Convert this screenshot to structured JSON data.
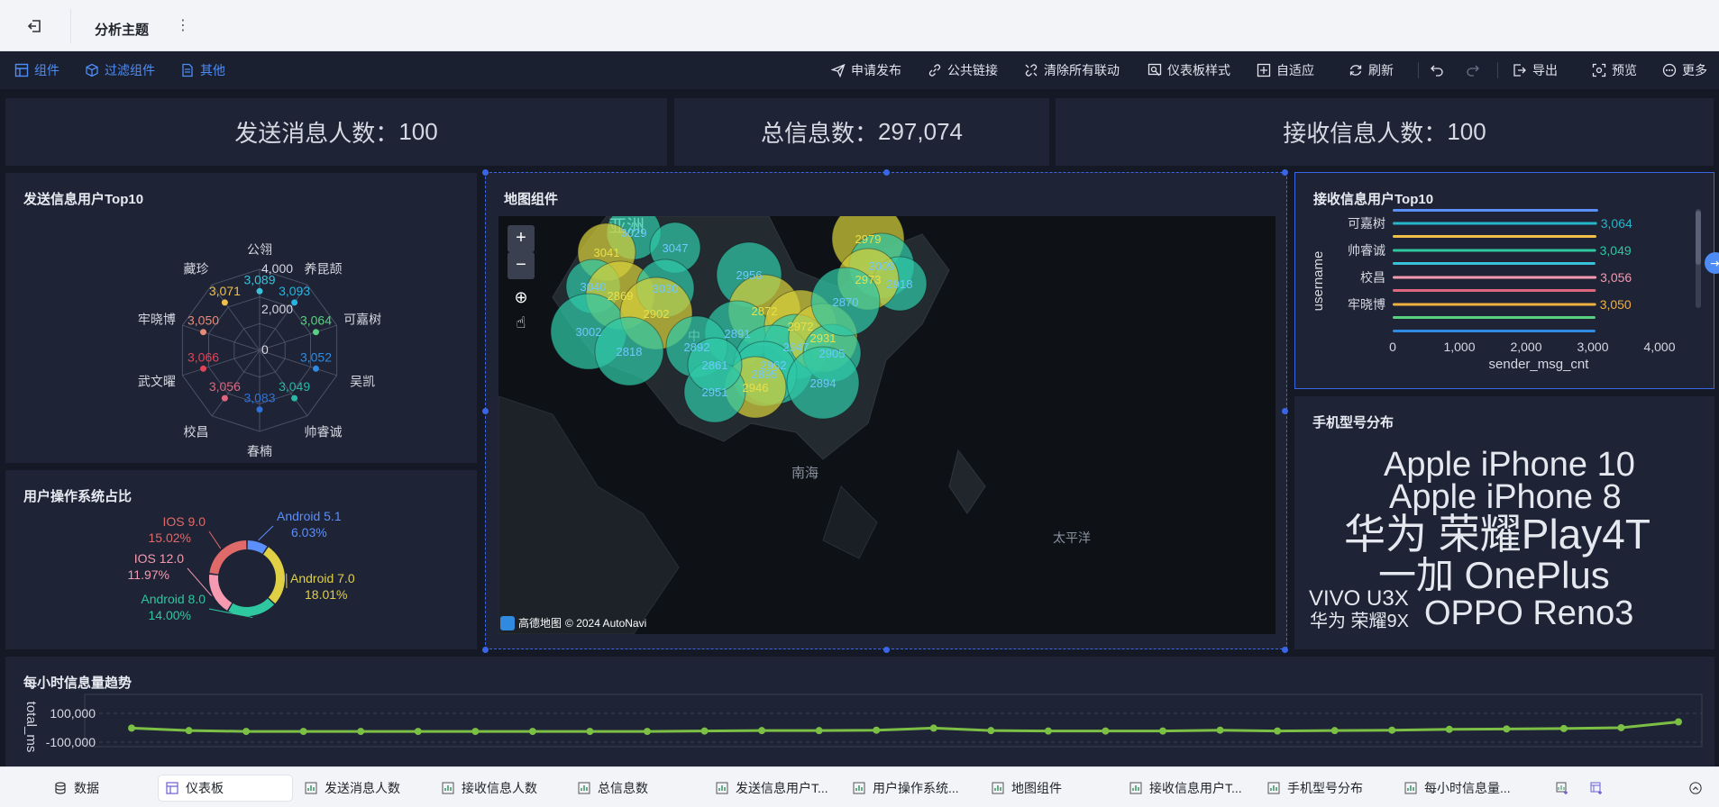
{
  "topbar": {
    "title": "分析主题"
  },
  "toolbar": {
    "left": [
      "组件",
      "过滤组件",
      "其他"
    ],
    "right": {
      "publish": "申请发布",
      "public_link": "公共链接",
      "clear_links": "清除所有联动",
      "style": "仪表板样式",
      "adapt": "自适应",
      "refresh": "刷新",
      "export": "导出",
      "preview": "预览",
      "more": "更多"
    }
  },
  "kpis": [
    {
      "label": "发送消息人数",
      "value": "100"
    },
    {
      "label": "总信息数",
      "value": "297,074"
    },
    {
      "label": "接收信息人数",
      "value": "100"
    }
  ],
  "cards": {
    "send_top10": "发送信息用户Top10",
    "os_share": "用户操作系统占比",
    "map": "地图组件",
    "recv_top10": "接收信息用户Top10",
    "phone_models": "手机型号分布",
    "hourly": "每小时信息量趋势"
  },
  "radar": {
    "axis_ticks": [
      "4,000",
      "2,000",
      "0"
    ],
    "names": [
      "公翎",
      "养昆颉",
      "可嘉树",
      "吴凯",
      "帅睿诚",
      "春楠",
      "校昌",
      "武文曜",
      "牢晓博",
      "藏珍"
    ],
    "values": [
      "3,089",
      "3,093",
      "3,064",
      "3,052",
      "3,049",
      "3,083",
      "3,056",
      "3,066",
      "3,050",
      "3,071"
    ],
    "colors": [
      "#38c2d9",
      "#27b5e0",
      "#58d080",
      "#2f8ae0",
      "#29b8a8",
      "#2f72d8",
      "#e0677e",
      "#e04458",
      "#e88a78",
      "#f0c048"
    ]
  },
  "chart_data": [
    {
      "type": "pie",
      "title": "用户操作系统占比",
      "labels": [
        "Android 5.1",
        "Android 7.0",
        "Android 8.0",
        "IOS 12.0",
        "IOS 9.0"
      ],
      "values": [
        6.03,
        18.01,
        14.0,
        11.97,
        15.02
      ],
      "percent_labels": [
        "6.03%",
        "18.01%",
        "14.00%",
        "11.97%",
        "15.02%"
      ],
      "colors": [
        "#5b8ff9",
        "#e0d046",
        "#2ec7a0",
        "#f59ab0",
        "#e06a6a"
      ]
    },
    {
      "type": "bar",
      "title": "接收信息用户Top10",
      "orientation": "horizontal",
      "categories": [
        "可嘉树",
        "帅睿诚",
        "校昌",
        "牢晓博"
      ],
      "values": [
        3064,
        3049,
        3056,
        3050
      ],
      "value_labels": [
        "3,064",
        "3,049",
        "3,056",
        "3,050"
      ],
      "label_colors": [
        "#27b5c9",
        "#2ec7a0",
        "#f59ab0",
        "#f0b040"
      ],
      "xlabel": "sender_msg_cnt",
      "ylabel": "username",
      "xticks": [
        "0",
        "1,000",
        "2,000",
        "3,000",
        "4,000"
      ],
      "xlim": [
        0,
        4000
      ]
    },
    {
      "type": "line",
      "title": "每小时信息量趋势",
      "ylabel": "total_ms",
      "yticks": [
        "100,000",
        "-100,000"
      ],
      "values": [
        20,
        8,
        4,
        4,
        4,
        4,
        4,
        4,
        4,
        4,
        6,
        8,
        8,
        10,
        20,
        8,
        6,
        6,
        6,
        10,
        6,
        8,
        10,
        14,
        16,
        18,
        22,
        50
      ],
      "color": "#7cbf45"
    }
  ],
  "map": {
    "label_asia": "亚洲",
    "label_south_sea": "南海",
    "label_pacific": "太平洋",
    "label_china": "中",
    "attribution": "高德地图",
    "copyright": "© 2024 AutoNavi",
    "bubble_values": [
      "3029",
      "3041",
      "3047",
      "3040",
      "2869",
      "3030",
      "3002",
      "2902",
      "2818",
      "2956",
      "2872",
      "2891",
      "2892",
      "2972",
      "2947",
      "2962",
      "2931",
      "2905",
      "2895",
      "2946",
      "2951",
      "2894",
      "2979",
      "3009",
      "2918",
      "2973",
      "2870",
      "2861"
    ]
  },
  "word_cloud": [
    {
      "text": "Apple iPhone 10",
      "color": "#6e9ff0"
    },
    {
      "text": "Apple iPhone 8",
      "color": "#6e9ff0"
    },
    {
      "text": "华为 荣耀Play4T",
      "color": "#8a6fe0"
    },
    {
      "text": "一加 OnePlus",
      "color": "#8a6fe0"
    },
    {
      "text": "VIVO U3X",
      "color": "#38b4e0"
    },
    {
      "text": "华为 荣耀9X",
      "color": "#38b4e0"
    },
    {
      "text": "OPPO Reno3",
      "color": "#6e9ff0"
    }
  ],
  "tabs": [
    "数据",
    "仪表板",
    "发送消息人数",
    "接收信息人数",
    "总信息数",
    "发送信息用户T...",
    "用户操作系统...",
    "地图组件",
    "接收信息用户T...",
    "手机型号分布",
    "每小时信息量..."
  ]
}
